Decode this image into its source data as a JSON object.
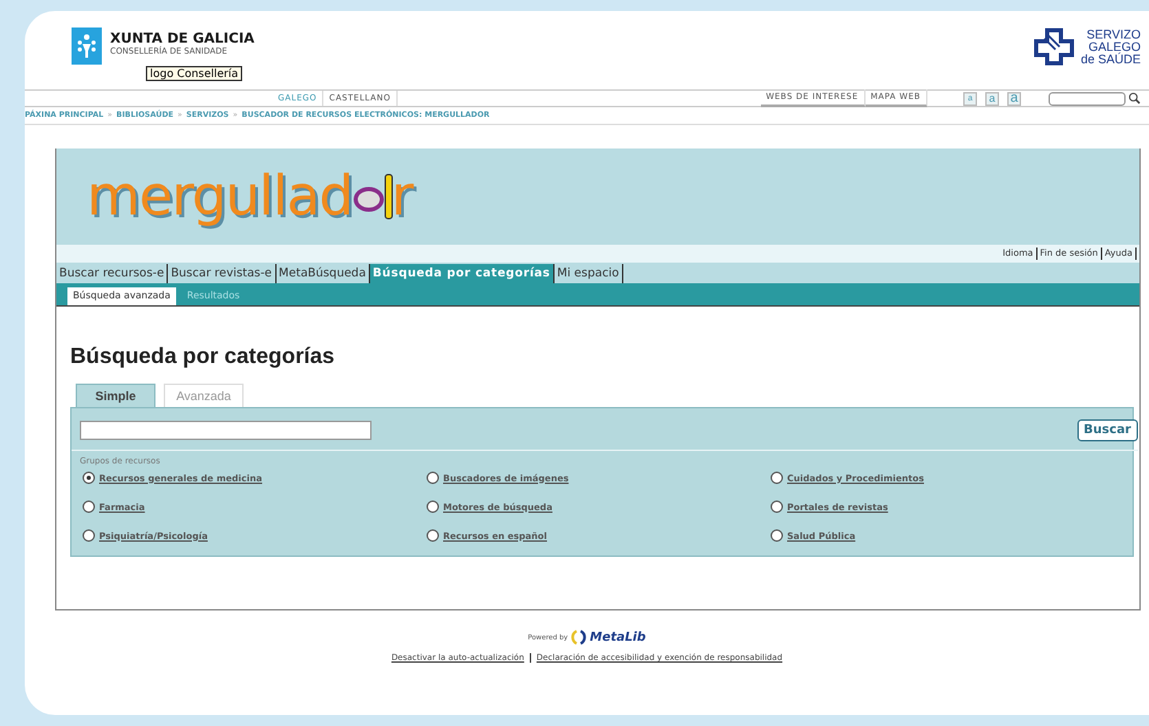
{
  "header": {
    "brand_title": "XUNTA DE GALICIA",
    "brand_subtitle": "CONSELLERÍA DE SANIDADE",
    "tooltip": "logo Consellería",
    "partner_logo": [
      "SERVIZO",
      "GALEGO",
      "de SAÚDE"
    ]
  },
  "language_links": [
    {
      "label": "GALEGO",
      "selected": true
    },
    {
      "label": "CASTELLANO",
      "selected": false
    }
  ],
  "top_links": [
    "WEBS DE INTERESE",
    "MAPA WEB"
  ],
  "text_size_buttons": [
    "a",
    "a",
    "a"
  ],
  "breadcrumb": {
    "separator": "»",
    "items": [
      "PÁXINA PRINCIPAL",
      "BIBLIOSAÚDE",
      "SERVIZOS",
      "BUSCADOR DE RECURSOS ELECTRÓNICOS: MERGULLADOR"
    ]
  },
  "app_logo": {
    "before": "mergullad",
    "after": "r"
  },
  "user_links": [
    "Idioma",
    "Fin de sesión",
    "Ayuda"
  ],
  "tabs": [
    {
      "label": "Buscar recursos-e",
      "selected": false
    },
    {
      "label": "Buscar revistas-e",
      "selected": false
    },
    {
      "label": "MetaBúsqueda",
      "selected": false
    },
    {
      "label": "Búsqueda por categorías",
      "selected": true
    },
    {
      "label": "Mi espacio",
      "selected": false
    }
  ],
  "subtabs": [
    {
      "label": "Búsqueda avanzada",
      "selected": true
    },
    {
      "label": "Resultados",
      "selected": false
    }
  ],
  "heading": "Búsqueda por categorías",
  "search_tabs": [
    {
      "label": "Simple",
      "selected": true
    },
    {
      "label": "Avanzada",
      "selected": false
    }
  ],
  "search_button": "Buscar",
  "group_label": "Grupos de recursos",
  "resources": [
    {
      "label": "Recursos generales de medicina",
      "selected": true
    },
    {
      "label": "Buscadores de imágenes",
      "selected": false
    },
    {
      "label": "Cuidados y Procedimientos",
      "selected": false
    },
    {
      "label": "Farmacia",
      "selected": false
    },
    {
      "label": "Motores de búsqueda",
      "selected": false
    },
    {
      "label": "Portales de revistas",
      "selected": false
    },
    {
      "label": "Psiquiatría/Psicología",
      "selected": false
    },
    {
      "label": "Recursos en español",
      "selected": false
    },
    {
      "label": "Salud Pública",
      "selected": false
    }
  ],
  "footer": {
    "powered_by": "Powered by",
    "product": "MetaLib",
    "links": [
      "Desactivar la auto-actualización",
      "Declaración de accesibilidad y exención de responsabilidad"
    ]
  }
}
